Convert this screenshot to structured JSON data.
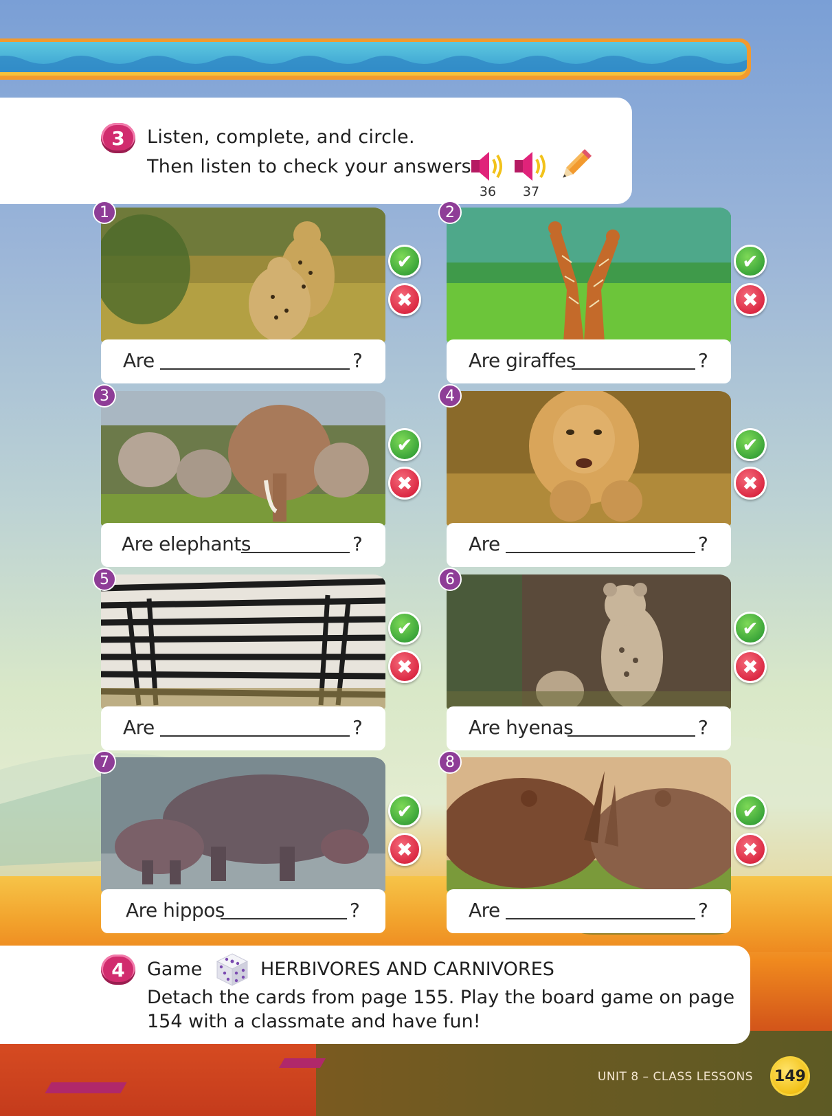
{
  "exercise3": {
    "number": "3",
    "line1": "Listen, complete, and circle.",
    "line2": "Then listen to check your answers.",
    "tracks": [
      "36",
      "37"
    ]
  },
  "cards": [
    {
      "num": "1",
      "prefix": "Are",
      "q": "?",
      "animal": "cheetahs"
    },
    {
      "num": "2",
      "prefix": "Are giraffes",
      "q": "?",
      "animal": "giraffes"
    },
    {
      "num": "3",
      "prefix": "Are elephants",
      "q": "?",
      "animal": "elephants"
    },
    {
      "num": "4",
      "prefix": "Are",
      "q": "?",
      "animal": "lions"
    },
    {
      "num": "5",
      "prefix": "Are",
      "q": "?",
      "animal": "zebras"
    },
    {
      "num": "6",
      "prefix": "Are hyenas",
      "q": "?",
      "animal": "hyenas"
    },
    {
      "num": "7",
      "prefix": "Are hippos",
      "q": "?",
      "animal": "hippos"
    },
    {
      "num": "8",
      "prefix": "Are",
      "q": "?",
      "animal": "rhinos"
    }
  ],
  "answer_marks": {
    "check": "✔",
    "cross": "✖"
  },
  "exercise4": {
    "number": "4",
    "label": "Game",
    "title": "HERBIVORES AND CARNIVORES",
    "line1": "Detach the cards from page 155. Play the board game on page",
    "line2": "154 with a classmate and have fun!"
  },
  "footer": {
    "unit": "UNIT 8 – CLASS LESSONS",
    "page": "149"
  },
  "icons": {
    "speaker": "speaker-icon",
    "pencil": "pencil-icon",
    "dice": "dice-icon"
  }
}
